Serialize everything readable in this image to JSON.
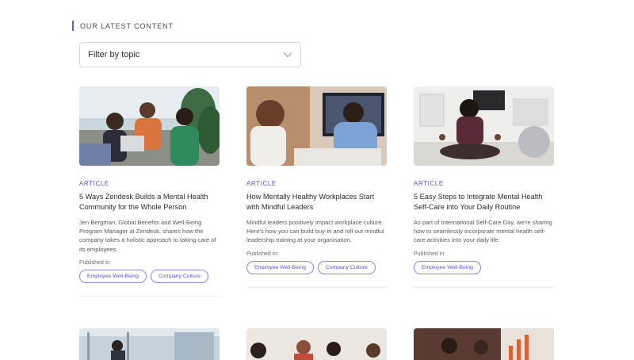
{
  "section_label": "OUR LATEST CONTENT",
  "filter": {
    "label": "Filter by topic",
    "icon": "chevron-down-icon"
  },
  "published_label": "Published in:",
  "cards": [
    {
      "tag": "ARTICLE",
      "title": "5 Ways Zendesk Builds a Mental Health Community for the Whole Person",
      "description": "Jen Bergman, Global Benefits and Well-Being Program Manager at Zendesk, shares how the company takes a holistic approach to taking care of its employees.",
      "chips": [
        "Employee Well-Being",
        "Company Culture"
      ]
    },
    {
      "tag": "ARTICLE",
      "title": "How Mentally Healthy Workplaces Start with Mindful Leaders",
      "description": "Mindful leaders positively impact workplace culture. Here's how you can build buy-in and roll out mindful leadership training at your organisation.",
      "chips": [
        "Employee Well-Being",
        "Company Culture"
      ]
    },
    {
      "tag": "ARTICLE",
      "title": "5 Easy Steps to Integrate Mental Health Self-Care into Your Daily Routine",
      "description": "As part of International Self-Care Day, we're sharing how to seamlessly incorporate mental health self-care activities into your daily life.",
      "chips": [
        "Employee Well-Being"
      ]
    }
  ],
  "colors": {
    "accent": "#5b4fd0",
    "chip_border": "#8d83df"
  }
}
